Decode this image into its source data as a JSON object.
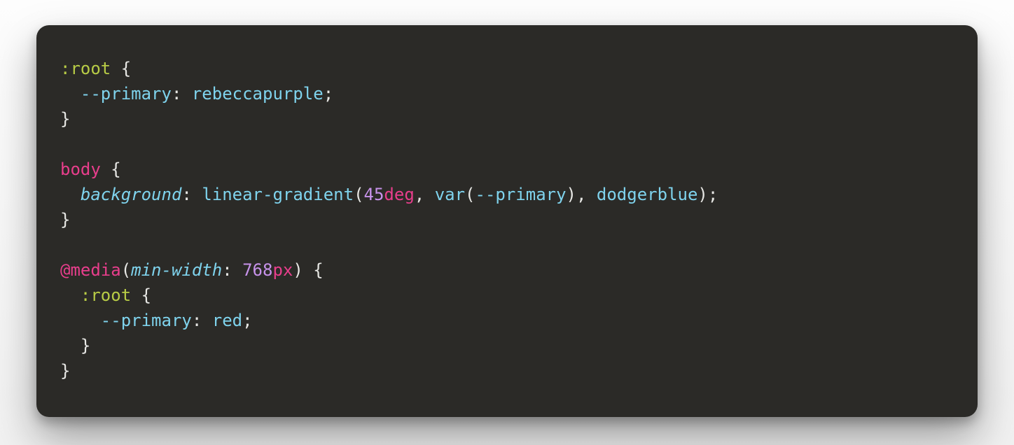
{
  "code": {
    "tokens": [
      {
        "cls": "c-selector",
        "text": ":root"
      },
      {
        "cls": "c-punc",
        "text": " {"
      },
      {
        "text": "\n  "
      },
      {
        "cls": "c-value",
        "text": "--primary"
      },
      {
        "cls": "c-punc",
        "text": ": "
      },
      {
        "cls": "c-value",
        "text": "rebeccapurple"
      },
      {
        "cls": "c-punc",
        "text": ";"
      },
      {
        "text": "\n"
      },
      {
        "cls": "c-punc",
        "text": "}"
      },
      {
        "text": "\n\n"
      },
      {
        "cls": "c-tag",
        "text": "body"
      },
      {
        "cls": "c-punc",
        "text": " {"
      },
      {
        "text": "\n  "
      },
      {
        "cls": "c-prop",
        "text": "background"
      },
      {
        "cls": "c-punc",
        "text": ": "
      },
      {
        "cls": "c-func",
        "text": "linear-gradient"
      },
      {
        "cls": "c-punc",
        "text": "("
      },
      {
        "cls": "c-num",
        "text": "45"
      },
      {
        "cls": "c-unit",
        "text": "deg"
      },
      {
        "cls": "c-punc",
        "text": ", "
      },
      {
        "cls": "c-func",
        "text": "var"
      },
      {
        "cls": "c-punc",
        "text": "("
      },
      {
        "cls": "c-value",
        "text": "--primary"
      },
      {
        "cls": "c-punc",
        "text": "), "
      },
      {
        "cls": "c-value",
        "text": "dodgerblue"
      },
      {
        "cls": "c-punc",
        "text": ");"
      },
      {
        "text": "\n"
      },
      {
        "cls": "c-punc",
        "text": "}"
      },
      {
        "text": "\n\n"
      },
      {
        "cls": "c-tag",
        "text": "@media"
      },
      {
        "cls": "c-punc",
        "text": "("
      },
      {
        "cls": "c-prop",
        "text": "min-width"
      },
      {
        "cls": "c-punc",
        "text": ": "
      },
      {
        "cls": "c-num",
        "text": "768"
      },
      {
        "cls": "c-unit",
        "text": "px"
      },
      {
        "cls": "c-punc",
        "text": ") {"
      },
      {
        "text": "\n  "
      },
      {
        "cls": "c-selector",
        "text": ":root"
      },
      {
        "cls": "c-punc",
        "text": " {"
      },
      {
        "text": "\n    "
      },
      {
        "cls": "c-value",
        "text": "--primary"
      },
      {
        "cls": "c-punc",
        "text": ": "
      },
      {
        "cls": "c-value",
        "text": "red"
      },
      {
        "cls": "c-punc",
        "text": ";"
      },
      {
        "text": "\n  "
      },
      {
        "cls": "c-punc",
        "text": "}"
      },
      {
        "text": "\n"
      },
      {
        "cls": "c-punc",
        "text": "}"
      }
    ]
  }
}
